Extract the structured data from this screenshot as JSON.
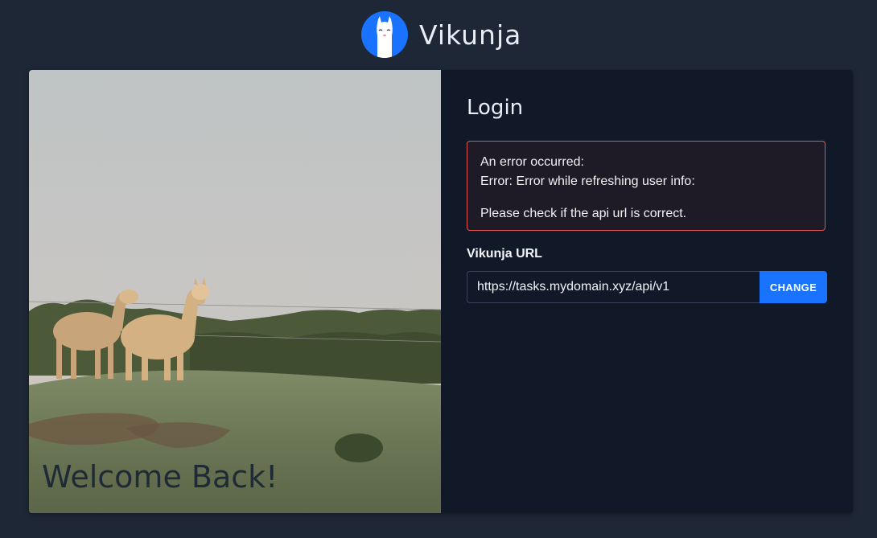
{
  "app": {
    "name": "Vikunja",
    "accent_color": "#1973ff",
    "background_color": "#1e2736"
  },
  "hero": {
    "image_subject": "two alpacas standing on a grassy hill under a pale sky",
    "welcome_text": "Welcome Back!"
  },
  "login": {
    "title": "Login",
    "error": {
      "line1": "An error occurred:",
      "line2": "Error: Error while refreshing user info:",
      "line3": "Please check if the api url is correct.",
      "border_color": "#e05454"
    },
    "url_field": {
      "label": "Vikunja URL",
      "value": "https://tasks.mydomain.xyz/api/v1",
      "placeholder": ""
    },
    "change_button_label": "CHANGE"
  }
}
